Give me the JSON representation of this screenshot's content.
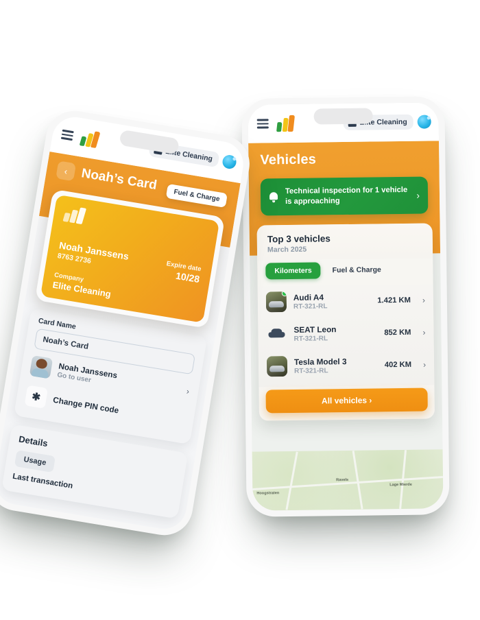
{
  "app": {
    "org_name": "Elite Cleaning",
    "menu_icon": "hamburger-menu-icon",
    "logo_icon": "brand-logo-icon",
    "briefcase_icon": "briefcase-icon",
    "avatar_icon": "user-avatar-icon"
  },
  "right_phone": {
    "page_title": "Vehicles",
    "notice": {
      "icon": "bell-icon",
      "text": "Technical inspection for 1 vehicle is approaching",
      "chevron": "›"
    },
    "panel": {
      "title": "Top 3 vehicles",
      "subtitle": "March 2025",
      "tabs": [
        {
          "label": "Kilometers",
          "active": true
        },
        {
          "label": "Fuel & Charge",
          "active": false
        }
      ],
      "vehicles": [
        {
          "name": "Audi A4",
          "plate": "RT-321-RL",
          "value": "1.421 KM",
          "icon": "vehicle-photo",
          "status": "online"
        },
        {
          "name": "SEAT Leon",
          "plate": "RT-321-RL",
          "value": "852 KM",
          "icon": "car-icon",
          "status": ""
        },
        {
          "name": "Tesla Model 3",
          "plate": "RT-321-RL",
          "value": "402 KM",
          "icon": "vehicle-photo",
          "status": ""
        }
      ],
      "all_button": "All vehicles ›"
    },
    "map_labels": [
      "Hoogstraten",
      "Ravels",
      "Lage Mierde"
    ]
  },
  "left_phone": {
    "back_icon": "‹",
    "page_title": "Noah’s Card",
    "fuel_chip": "Fuel & Charge",
    "card": {
      "holder": "Noah Janssens",
      "number": "8763 2736",
      "expire_label": "Expire date",
      "expire_value": "10/28",
      "company_label": "Company",
      "company_value": "Elite Cleaning"
    },
    "form": {
      "card_name_label": "Card Name",
      "card_name_value": "Noah’s Card"
    },
    "rows": [
      {
        "title": "Noah Janssens",
        "subtitle": "Go to user",
        "icon": "user-avatar-icon"
      },
      {
        "title": "Change PIN code",
        "subtitle": "",
        "icon": "asterisk-icon"
      }
    ],
    "details": {
      "title": "Details",
      "tab": "Usage",
      "last_transaction": "Last transaction"
    }
  },
  "colors": {
    "orange": "#ef9b2e",
    "green": "#21963c",
    "card_yellow": "#f4c01b",
    "logo_green": "#2f9e41",
    "logo_yellow": "#f2c417",
    "logo_orange": "#f08c1e"
  }
}
